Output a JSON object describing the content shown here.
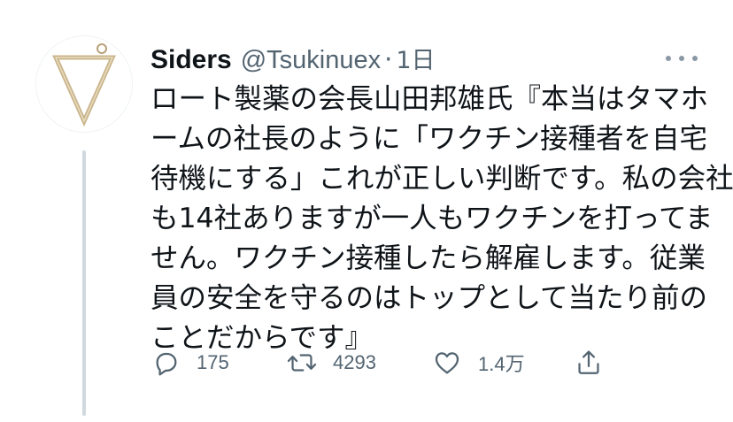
{
  "tweet": {
    "author": {
      "display_name": "Siders",
      "handle": "@Tsukinuex",
      "separator": "·",
      "time": "1日",
      "avatar_icon": "inverted-triangle-pendant-icon"
    },
    "more_icon": "more-dots-icon",
    "text_lines": [
      "ロート製薬の会長山田邦雄氏『本当はタマホ",
      "ームの社長のように「ワクチン接種者を自宅",
      "待機にする」これが正しい判断です。私の会社",
      "も14社ありますが一人もワクチンを打ってま",
      "せん。ワクチン接種したら解雇します。従業",
      "員の安全を守るのはトップとして当たり前の",
      "ことだからです』"
    ],
    "actions": {
      "reply": {
        "icon": "reply-icon",
        "count": "175"
      },
      "retweet": {
        "icon": "retweet-icon",
        "count": "4293"
      },
      "like": {
        "icon": "heart-icon",
        "count": "1.4万"
      },
      "share": {
        "icon": "share-icon"
      }
    }
  },
  "colors": {
    "text": "#0f1419",
    "secondary": "#536471",
    "thread_line": "#cfd9de",
    "avatar_gold": "#c9b48a"
  }
}
